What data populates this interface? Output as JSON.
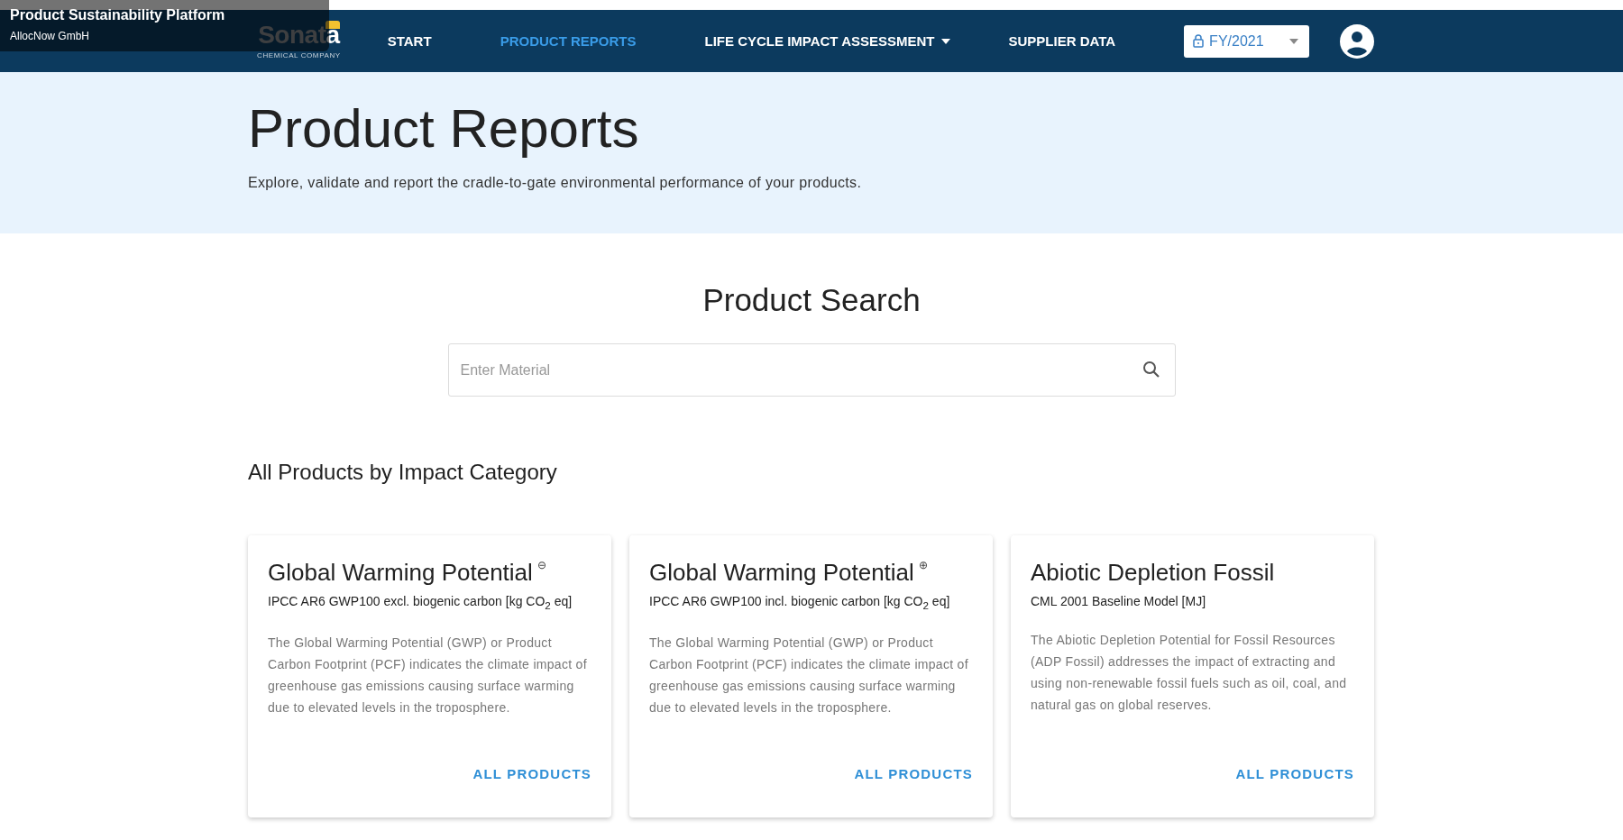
{
  "overlay": {
    "title": "Product Sustainability Platform",
    "subtitle": "AllocNow GmbH"
  },
  "header": {
    "logo": {
      "name": "Sonata",
      "tagline": "CHEMICAL COMPANY"
    },
    "nav": [
      {
        "label": "START",
        "kind": "link",
        "selected": false
      },
      {
        "label": "PRODUCT REPORTS",
        "kind": "link",
        "selected": true
      },
      {
        "label": "LIFE CYCLE IMPACT ASSESSMENT",
        "kind": "dropdown",
        "selected": false
      },
      {
        "label": "SUPPLIER DATA",
        "kind": "link",
        "selected": false
      }
    ],
    "period_select": {
      "value": "FY/2021"
    }
  },
  "hero": {
    "title": "Product Reports",
    "subtitle": "Explore, validate and report the cradle-to-gate environmental performance of your products."
  },
  "search": {
    "heading": "Product Search",
    "placeholder": "Enter Material"
  },
  "section_title": "All Products by Impact Category",
  "cards": [
    {
      "title": "Global Warming Potential",
      "title_mark": "⊖",
      "method": "IPCC AR6 GWP100 excl. biogenic carbon [kg CO$_{2}$ eq]",
      "description": "The Global Warming Potential (GWP) or Product Carbon Footprint (PCF) indicates the climate impact of greenhouse gas emissions causing surface warming due to elevated levels in the troposphere.",
      "action": "ALL PRODUCTS"
    },
    {
      "title": "Global Warming Potential",
      "title_mark": "⊕",
      "method": "IPCC AR6 GWP100 incl. biogenic carbon [kg CO$_{2}$ eq]",
      "description": "The Global Warming Potential (GWP) or Product Carbon Footprint (PCF) indicates the climate impact of greenhouse gas emissions causing surface warming due to elevated levels in the troposphere.",
      "action": "ALL PRODUCTS"
    },
    {
      "title": "Abiotic Depletion Fossil",
      "method": "CML 2001 Baseline Model [MJ]",
      "description": "The Abiotic Depletion Potential for Fossil Resources (ADP Fossil) addresses the impact of extracting and using non-renewable fossil fuels such as oil, coal, and natural gas on global reserves.",
      "action": "ALL PRODUCTS"
    }
  ]
}
